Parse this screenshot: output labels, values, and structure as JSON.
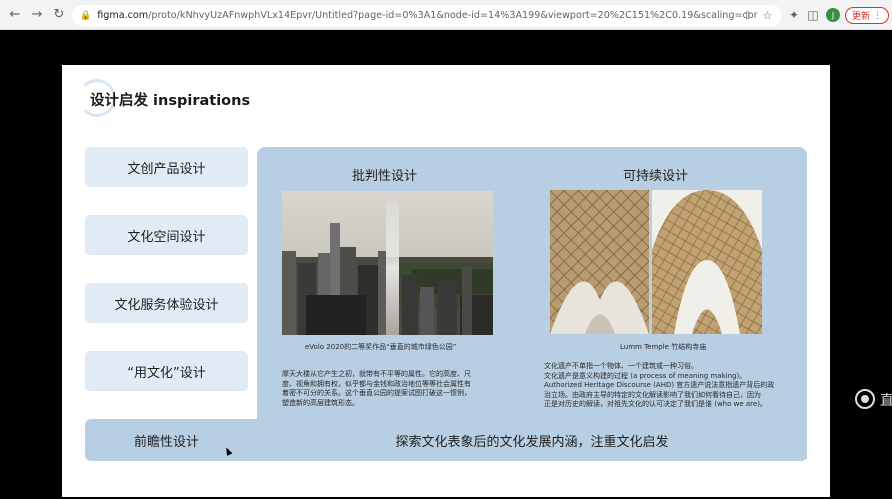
{
  "browser": {
    "url_host": "figma.com",
    "url_path": "/proto/kNhvyUzAFnwphVLx14Epvr/Untitled?page-id=0%3A1&node-id=14%3A199&viewport=20%2C151%2C0.19&scaling=contain&starting-point-...",
    "avatar_letter": "J",
    "update_label": "更新",
    "icons": [
      "back-icon",
      "forward-icon",
      "reload-icon",
      "lock-icon",
      "share-icon",
      "star-icon",
      "extensions-icon",
      "sidebar-icon",
      "menu-icon"
    ]
  },
  "slide": {
    "title": "设计启发 inspirations",
    "menu": [
      "文创产品设计",
      "文化空间设计",
      "文化服务体验设计",
      "“用文化”设计",
      "前瞻性设计"
    ],
    "left_column": {
      "title": "批判性设计",
      "caption": "eVolo 2020的二等奖作品“垂直的城市绿色公园”",
      "description": [
        "摩天大楼从它产生之初，就带有不平等的属性。它的高度、尺",
        "度、视角和拥有权，似乎都与金钱和政治地位等等社会属性有",
        "着密不可分的关系。这个垂直公园的提案试图打破这一惯例，",
        "塑造新的高层建筑形态。"
      ]
    },
    "right_column": {
      "title": "可持续设计",
      "caption": "Lumm Temple 竹结构寺庙",
      "description": [
        "文化遗产不单指一个物体、一个建筑或一种习俗。",
        "文化遗产是意义构建的过程 (a process of meaning making)。",
        "Authorized Heritage Discourse (AHD) 官方遗产说法意指遗产背后的政",
        "治立场。由政府主导的特定的文化解读影响了我们如何看待自己，因为",
        "正是对历史的解读，对祖先文化的认可决定了我们是谁 (who we are)。"
      ]
    },
    "bottom_text": "探索文化表象后的文化发展内涵，注重文化启发"
  },
  "side_text": "直",
  "colors": {
    "panel": "#b8cee2",
    "menu_item": "#e0ebf6",
    "update_red": "#d93025"
  }
}
